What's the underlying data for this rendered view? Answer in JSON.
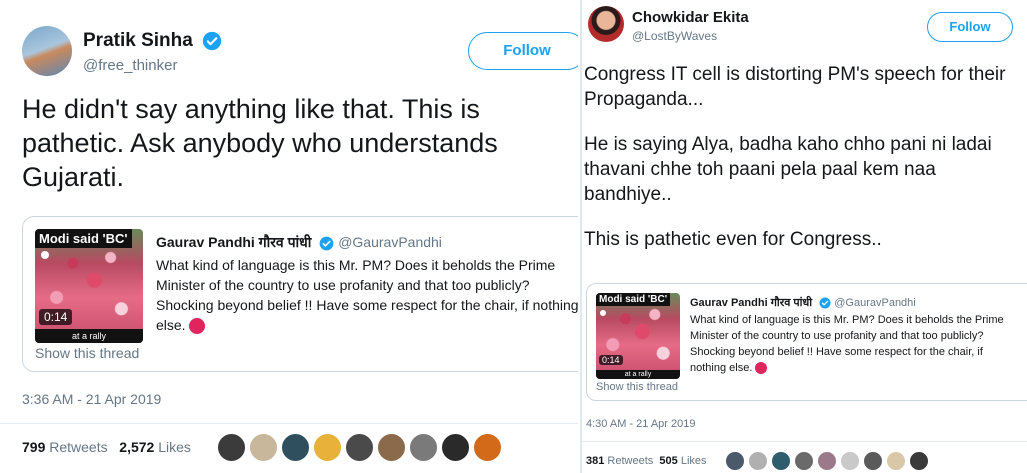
{
  "left_tweet": {
    "author_name": "Pratik Sinha",
    "author_handle": "@free_thinker",
    "follow_label": "Follow",
    "text": "He didn't say anything like that. This is pathetic. Ask anybody who understands Gujarati.",
    "quote": {
      "thumb_title": "Modi said 'BC'",
      "thumb_duration": "0:14",
      "thumb_caption": "at a rally",
      "author_name": "Gaurav Pandhi गौरव पांधी",
      "author_handle": "@GauravPandhi",
      "text": "What kind of language is this Mr. PM? Does it beholds the Prime Minister of the country to use profanity and that too publicly? Shocking beyond belief !! Have some respect for the chair, if nothing else.",
      "show_thread": "Show this thread"
    },
    "timestamp": "3:36 AM - 21 Apr 2019",
    "retweets_count": "799",
    "retweets_label": "Retweets",
    "likes_count": "2,572",
    "likes_label": "Likes"
  },
  "right_tweet": {
    "author_name": "Chowkidar Ekita",
    "author_handle": "@LostByWaves",
    "follow_label": "Follow",
    "text_p1": "Congress IT cell is distorting PM's speech for their Propaganda...",
    "text_p2": "He is saying Alya, badha kaho chho pani ni ladai thavani chhe toh paani pela paal kem naa bandhiye..",
    "text_p3": "This is pathetic even for Congress..",
    "quote": {
      "thumb_title": "Modi said 'BC'",
      "thumb_duration": "0:14",
      "thumb_caption": "at a rally",
      "author_name": "Gaurav Pandhi गौरव पांधी",
      "author_handle": "@GauravPandhi",
      "text": "What kind of language is this Mr. PM? Does it beholds the Prime Minister of the country to use profanity and that too publicly? Shocking beyond belief !! Have some respect for the chair, if nothing else.",
      "show_thread": "Show this thread"
    },
    "timestamp": "4:30 AM - 21 Apr 2019",
    "retweets_count": "381",
    "retweets_label": "Retweets",
    "likes_count": "505",
    "likes_label": "Likes"
  },
  "colors": {
    "accent": "#1da1f2",
    "secondary_text": "#657786",
    "border": "#ccd6dd",
    "emoji_red": "#e0245e"
  },
  "left_likers": [
    "#3b3b3b",
    "#c9b79c",
    "#2f4f5f",
    "#e8b23a",
    "#4a4a4a",
    "#8a6a4a",
    "#7a7a7a",
    "#2a2a2a",
    "#d26a1a"
  ],
  "right_likers": [
    "#4a5a6a",
    "#b0b0b0",
    "#2e5e6e",
    "#6a6a6a",
    "#9a7a8a",
    "#c9c9c9",
    "#5a5a5a",
    "#d8c8a8",
    "#3a3a3a"
  ]
}
